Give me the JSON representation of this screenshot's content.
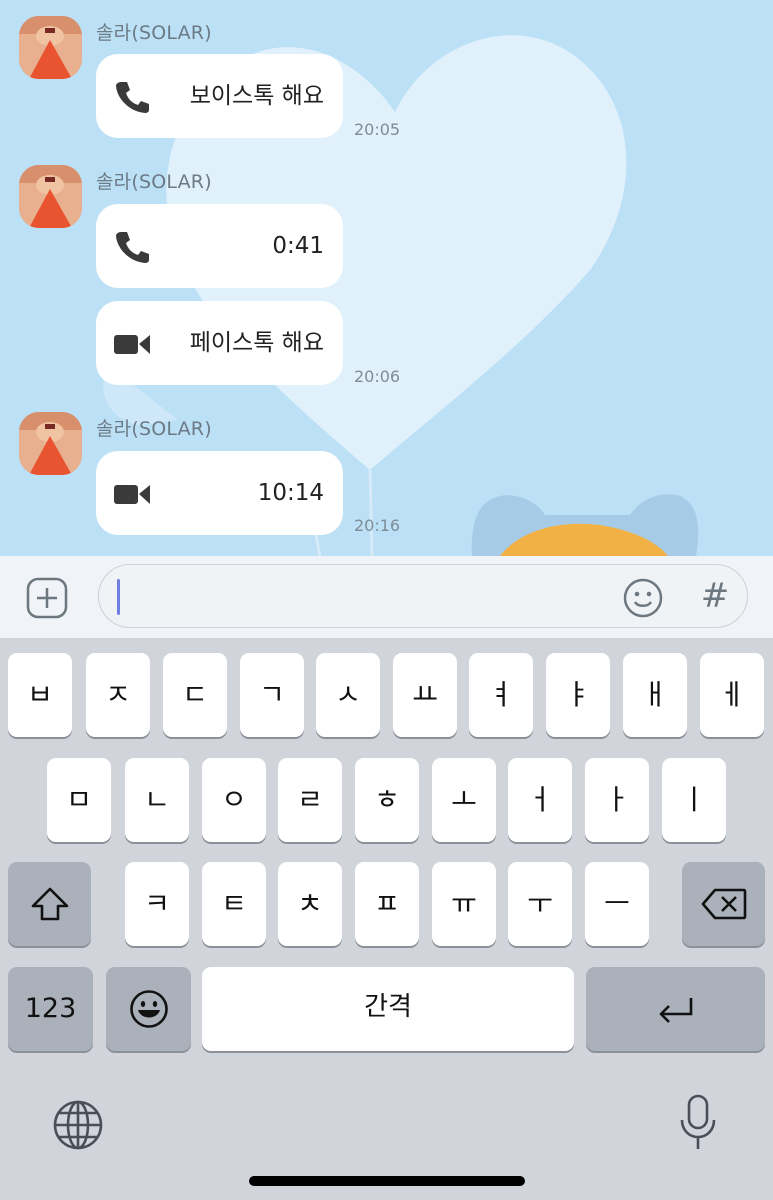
{
  "chat": {
    "groups": [
      {
        "sender": "솔라(SOLAR)",
        "time": "20:05",
        "bubbles": [
          {
            "icon": "phone-icon",
            "text": "보이스톡 해요"
          }
        ]
      },
      {
        "sender": "솔라(SOLAR)",
        "time": "20:06",
        "bubbles": [
          {
            "icon": "phone-icon",
            "text": "0:41"
          },
          {
            "icon": "video-camera-icon",
            "text": "페이스톡 해요"
          }
        ]
      },
      {
        "sender": "솔라(SOLAR)",
        "time": "20:16",
        "bubbles": [
          {
            "icon": "video-camera-icon",
            "text": "10:14"
          }
        ]
      }
    ]
  },
  "input": {
    "value": "",
    "hash_label": "#"
  },
  "keyboard": {
    "row1": [
      "ㅂ",
      "ㅈ",
      "ㄷ",
      "ㄱ",
      "ㅅ",
      "ㅛ",
      "ㅕ",
      "ㅑ",
      "ㅐ",
      "ㅔ"
    ],
    "row2": [
      "ㅁ",
      "ㄴ",
      "ㅇ",
      "ㄹ",
      "ㅎ",
      "ㅗ",
      "ㅓ",
      "ㅏ",
      "ㅣ"
    ],
    "row3": [
      "ㅋ",
      "ㅌ",
      "ㅊ",
      "ㅍ",
      "ㅠ",
      "ㅜ",
      "ㅡ"
    ],
    "numbers_label": "123",
    "space_label": "간격"
  },
  "colors": {
    "chat_bg": "#bce0f5",
    "bubble": "#ffffff",
    "keyboard_bg": "#d1d4db",
    "caret": "#6f7fe0"
  }
}
